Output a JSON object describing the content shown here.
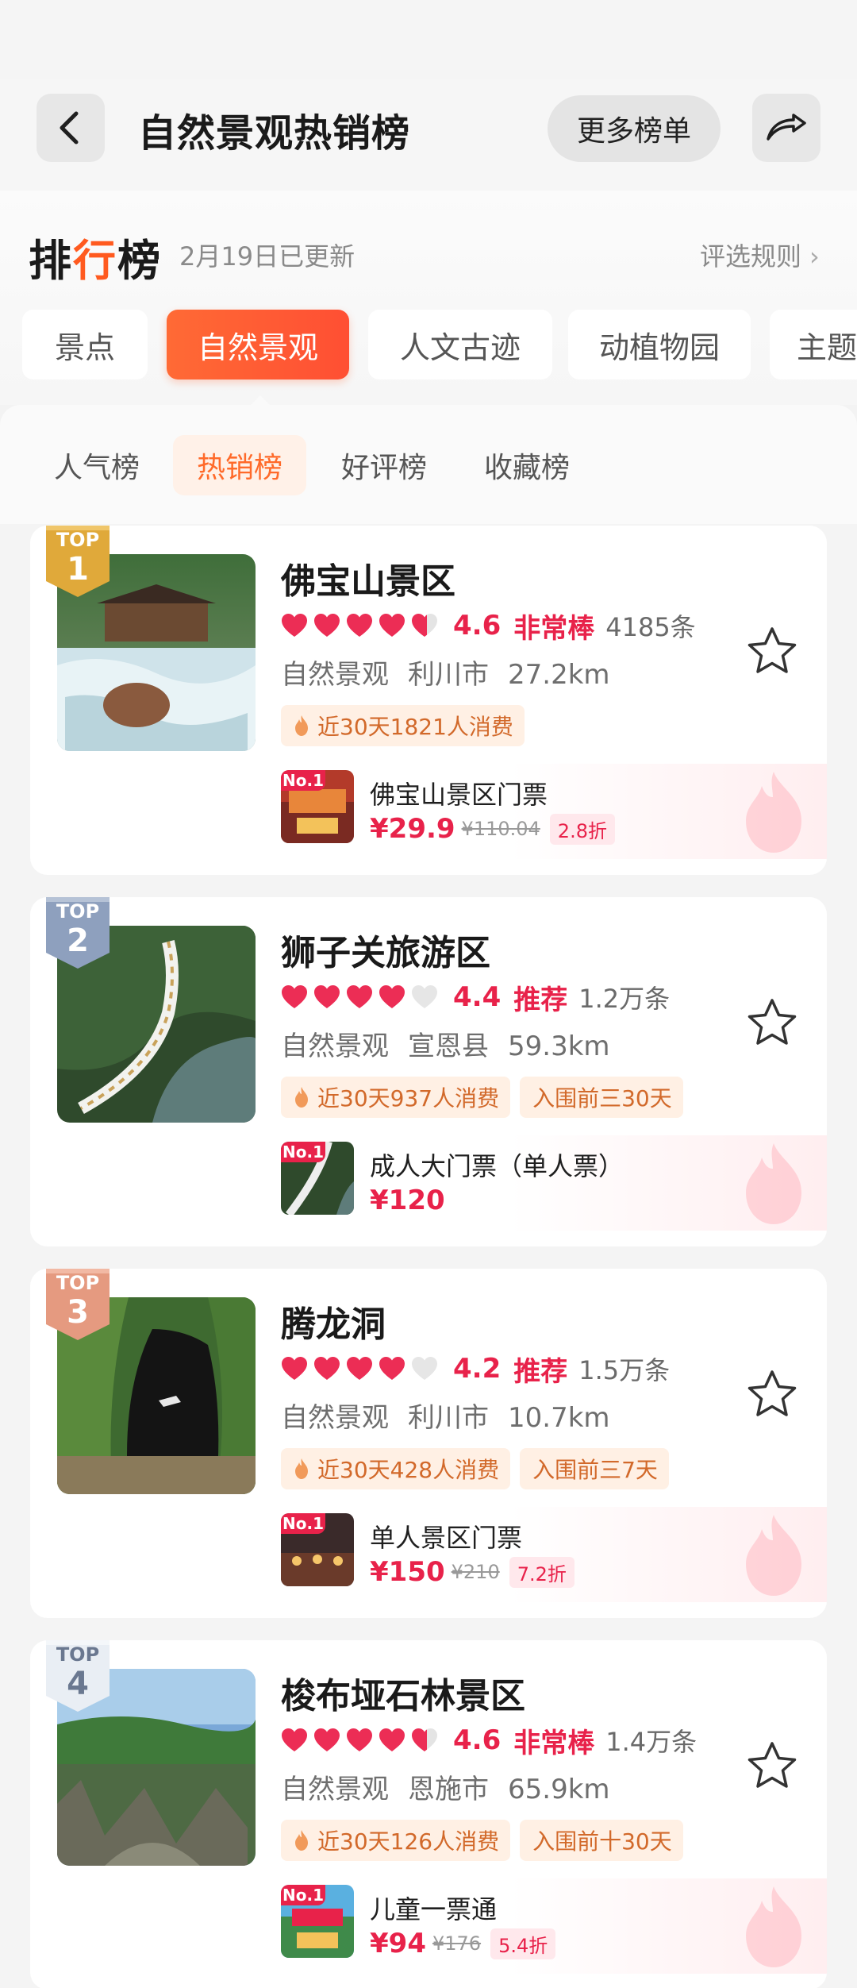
{
  "header": {
    "title": "自然景观热销榜",
    "more_label": "更多榜单"
  },
  "ranking": {
    "title_pre": "排",
    "title_mid": "行",
    "title_post": "榜",
    "updated": "2月19日已更新",
    "rules_label": "评选规则",
    "category_tabs": [
      "景点",
      "自然景观",
      "人文古迹",
      "动植物园",
      "主题"
    ],
    "active_category": "自然景观",
    "sub_tabs": [
      "人气榜",
      "热销榜",
      "好评榜",
      "收藏榜"
    ],
    "active_sub_tab": "热销榜"
  },
  "colors": {
    "accent": "#ff5a2a",
    "price": "#e8224a",
    "tag_bg": "#fff0e4",
    "gold": "#e0a93a",
    "silver": "#8ea0be",
    "bronze": "#e59a80"
  },
  "items": [
    {
      "rank_label": "TOP",
      "rank": "1",
      "name": "佛宝山景区",
      "hearts_full": 4,
      "hearts_partial": 1,
      "score": "4.6",
      "score_label": "非常棒",
      "reviews": "4185条",
      "category": "自然景观",
      "city": "利川市",
      "distance": "27.2km",
      "tags": [
        "近30天1821人消费"
      ],
      "deal": {
        "badge": "No.1",
        "name": "佛宝山景区门票",
        "price": "¥29.9",
        "original": "¥110.04",
        "discount": "2.8折"
      }
    },
    {
      "rank_label": "TOP",
      "rank": "2",
      "name": "狮子关旅游区",
      "hearts_full": 4,
      "hearts_partial": 0,
      "score": "4.4",
      "score_label": "推荐",
      "reviews": "1.2万条",
      "category": "自然景观",
      "city": "宣恩县",
      "distance": "59.3km",
      "tags": [
        "近30天937人消费",
        "入围前三30天"
      ],
      "deal": {
        "badge": "No.1",
        "name": "成人大门票（单人票）",
        "price": "¥120",
        "original": "",
        "discount": ""
      }
    },
    {
      "rank_label": "TOP",
      "rank": "3",
      "name": "腾龙洞",
      "hearts_full": 4,
      "hearts_partial": 0,
      "score": "4.2",
      "score_label": "推荐",
      "reviews": "1.5万条",
      "category": "自然景观",
      "city": "利川市",
      "distance": "10.7km",
      "tags": [
        "近30天428人消费",
        "入围前三7天"
      ],
      "deal": {
        "badge": "No.1",
        "name": "单人景区门票",
        "price": "¥150",
        "original": "¥210",
        "discount": "7.2折"
      }
    },
    {
      "rank_label": "TOP",
      "rank": "4",
      "name": "梭布垭石林景区",
      "hearts_full": 4,
      "hearts_partial": 1,
      "score": "4.6",
      "score_label": "非常棒",
      "reviews": "1.4万条",
      "category": "自然景观",
      "city": "恩施市",
      "distance": "65.9km",
      "tags": [
        "近30天126人消费",
        "入围前十30天"
      ],
      "deal": {
        "badge": "No.1",
        "name": "儿童一票通",
        "price": "¥94",
        "original": "¥176",
        "discount": "5.4折"
      }
    }
  ]
}
